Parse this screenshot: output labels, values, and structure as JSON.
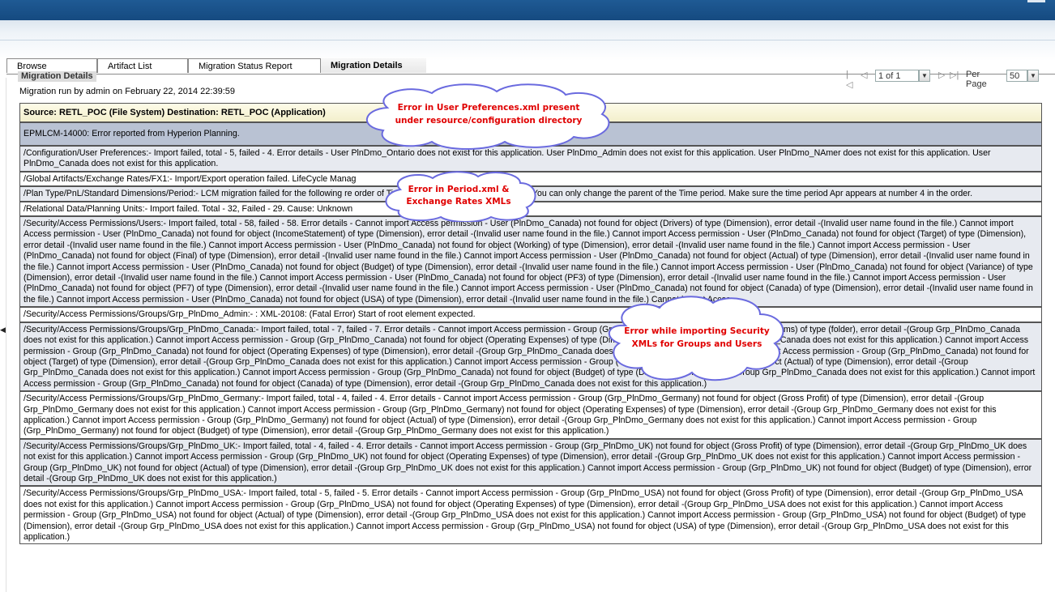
{
  "tabs": [
    {
      "label": "Browse"
    },
    {
      "label": "Artifact List"
    },
    {
      "label": "Migration Status Report"
    },
    {
      "label": "Migration Details"
    }
  ],
  "section_title": "Migration Details",
  "pager": {
    "page_value": "1 of 1",
    "per_page_label": "Per Page",
    "per_page_value": "50"
  },
  "run_info": "Migration run by admin on February 22, 2014 22:39:59",
  "header": "Source:  RETL_POC (File System)    Destination:  RETL_POC (Application)",
  "rows": [
    {
      "text": "EPMLCM-14000: Error reported from Hyperion Planning."
    },
    {
      "text": "/Configuration/User Preferences:- Import failed, total - 5, failed - 4. Error details - User PlnDmo_Ontario does not exist for this application. User PlnDmo_Admin does not exist for this application. User PlnDmo_NAmer does not exist for this application. User PlnDmo_Canada does not exist for this application."
    },
    {
      "text": "/Global Artifacts/Exchange Rates/FX1:- Import/Export operation failed. LifeCycle Manag"
    },
    {
      "text": "/Plan Type/PnL/Standard Dimensions/Period:- LCM migration failed for the following re                                        order of Time period members once deployed. You can only change the parent of the Time period. Make sure the time period Apr appears at number 4 in the order."
    },
    {
      "text": "/Relational Data/Planning Units:- Import failed. Total - 32, Failed - 29. Cause: Unknown"
    },
    {
      "text": "/Security/Access Permissions/Users:- Import failed, total - 58, failed - 58. Error details - Cannot import Access permission - User (PlnDmo_Canada) not found for object (Drivers) of type (Dimension), error detail -(Invalid user name found in the file.) Cannot import Access permission - User (PlnDmo_Canada) not found for object (IncomeStatement) of type (Dimension), error detail -(Invalid user name found in the file.) Cannot import Access permission - User (PlnDmo_Canada) not found for object (Target) of type (Dimension), error detail -(Invalid user name found in the file.) Cannot import Access permission - User (PlnDmo_Canada) not found for object (Working) of type (Dimension), error detail -(Invalid user name found in the file.) Cannot import Access permission - User (PlnDmo_Canada) not found for object (Final) of type (Dimension), error detail -(Invalid user name found in the file.) Cannot import Access permission - User (PlnDmo_Canada) not found for object (Actual) of type (Dimension), error detail -(Invalid user name found in the file.) Cannot import Access permission - User (PlnDmo_Canada) not found for object (Budget) of type (Dimension), error detail -(Invalid user name found in the file.) Cannot import Access permission - User (PlnDmo_Canada) not found for object (Variance) of type (Dimension), error detail -(Invalid user name found in the file.) Cannot import Access permission - User (PlnDmo_Canada) not found for object (PF3) of type (Dimension), error detail -(Invalid user name found in the file.) Cannot import Access permission - User (PlnDmo_Canada) not found for object (PF7) of type (Dimension), error detail -(Invalid user name found in the file.) Cannot import Access permission - User (PlnDmo_Canada) not found for object (Canada) of type (Dimension), error detail -(Invalid user name found in the file.) Cannot import Access permission - User (PlnDmo_Canada) not found for object (USA) of type (Dimension), error detail -(Invalid user name found in the file.) Cannot import Acces.."
    },
    {
      "text": "/Security/Access Permissions/Groups/Grp_PlnDmo_Admin:- : XML-20108: (Fatal Error) Start of root element expected."
    },
    {
      "text": "/Security/Access Permissions/Groups/Grp_PlnDmo_Canada:- Import failed, total - 7, failed - 7. Error details - Cannot import Access permission - Group (Grp_PlnDmo_Canada) not found for object (Forms) of type (folder), error detail -(Group Grp_PlnDmo_Canada does not exist for this application.) Cannot import Access permission - Group (Grp_PlnDmo_Canada) not found for object (Operating Expenses) of type (Dimension), error detail -(Group Grp_PlnDmo_Canada does not exist for this application.) Cannot import Access permission - Group (Grp_PlnDmo_Canada) not found for object (Operating Expenses) of type (Dimension), error detail -(Group Grp_PlnDmo_Canada does not exist for this application.) Cannot import Access permission - Group (Grp_PlnDmo_Canada) not found for object (Target) of type (Dimension), error detail -(Group Grp_PlnDmo_Canada does not exist for this application.) Cannot import Access permission - Group (Grp_PlnDmo_Canada) not found for object (Actual) of type (Dimension), error detail -(Group Grp_PlnDmo_Canada does not exist for this application.) Cannot import Access permission - Group (Grp_PlnDmo_Canada) not found for object (Budget) of type (Dimension), error detail -(Group Grp_PlnDmo_Canada does not exist for this application.) Cannot import Access permission - Group (Grp_PlnDmo_Canada) not found for object (Canada) of type (Dimension), error detail -(Group Grp_PlnDmo_Canada does not exist for this application.)"
    },
    {
      "text": "/Security/Access Permissions/Groups/Grp_PlnDmo_Germany:- Import failed, total - 4, failed - 4. Error details - Cannot import Access permission - Group (Grp_PlnDmo_Germany) not found for object (Gross Profit) of type (Dimension), error detail -(Group Grp_PlnDmo_Germany does not exist for this application.) Cannot import Access permission - Group (Grp_PlnDmo_Germany) not found for object (Operating Expenses) of type (Dimension), error detail -(Group Grp_PlnDmo_Germany does not exist for this application.) Cannot import Access permission - Group (Grp_PlnDmo_Germany) not found for object (Actual) of type (Dimension), error detail -(Group Grp_PlnDmo_Germany does not exist for this application.) Cannot import Access permission - Group (Grp_PlnDmo_Germany) not found for object (Budget) of type (Dimension), error detail -(Group Grp_PlnDmo_Germany does not exist for this application.)"
    },
    {
      "text": "/Security/Access Permissions/Groups/Grp_PlnDmo_UK:- Import failed, total - 4, failed - 4. Error details - Cannot import Access permission - Group (Grp_PlnDmo_UK) not found for object (Gross Profit) of type (Dimension), error detail -(Group Grp_PlnDmo_UK does not exist for this application.) Cannot import Access permission - Group (Grp_PlnDmo_UK) not found for object (Operating Expenses) of type (Dimension), error detail -(Group Grp_PlnDmo_UK does not exist for this application.) Cannot import Access permission - Group (Grp_PlnDmo_UK) not found for object (Actual) of type (Dimension), error detail -(Group Grp_PlnDmo_UK does not exist for this application.) Cannot import Access permission - Group (Grp_PlnDmo_UK) not found for object (Budget) of type (Dimension), error detail -(Group Grp_PlnDmo_UK does not exist for this application.)"
    },
    {
      "text": "/Security/Access Permissions/Groups/Grp_PlnDmo_USA:- Import failed, total - 5, failed - 5. Error details - Cannot import Access permission - Group (Grp_PlnDmo_USA) not found for object (Gross Profit) of type (Dimension), error detail -(Group Grp_PlnDmo_USA does not exist for this application.) Cannot import Access permission - Group (Grp_PlnDmo_USA) not found for object (Operating Expenses) of type (Dimension), error detail -(Group Grp_PlnDmo_USA does not exist for this application.) Cannot import Access permission - Group (Grp_PlnDmo_USA) not found for object (Actual) of type (Dimension), error detail -(Group Grp_PlnDmo_USA does not exist for this application.) Cannot import Access permission - Group (Grp_PlnDmo_USA) not found for object (Budget) of type (Dimension), error detail -(Group Grp_PlnDmo_USA does not exist for this application.) Cannot import Access permission - Group (Grp_PlnDmo_USA) not found for object (USA) of type (Dimension), error detail -(Group Grp_PlnDmo_USA does not exist for this application.)"
    }
  ],
  "callouts": [
    {
      "line1": "Error in User Preferences.xml present",
      "line2": "under resource/configuration directory"
    },
    {
      "line1": "Error in Period.xml &",
      "line2": "Exchange Rates XMLs"
    },
    {
      "line1": "Error while importing Security",
      "line2": "XMLs for Groups and Users"
    }
  ],
  "colors": {
    "callout_text": "#e00000",
    "callout_border": "#6a6adf",
    "highlight_row": "#b9c2d3",
    "alt_row": "#e7eaf0"
  }
}
